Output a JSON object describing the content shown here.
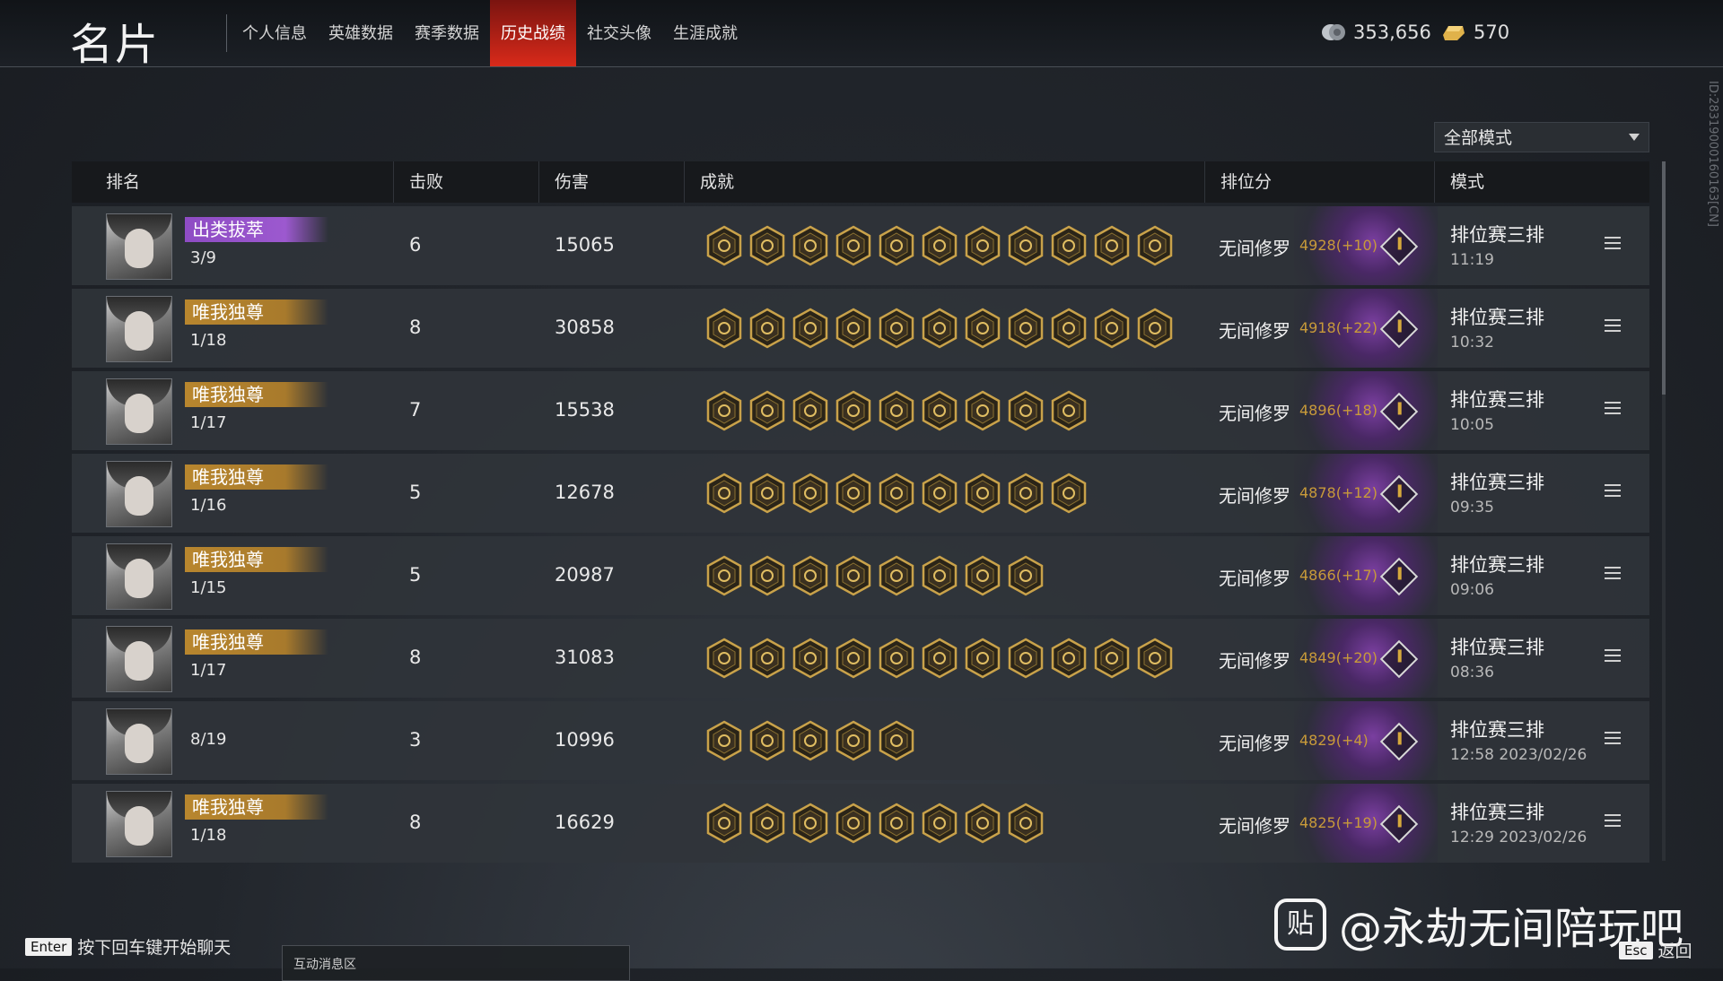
{
  "header": {
    "title": "名片",
    "tabs": [
      {
        "label": "个人信息",
        "active": false
      },
      {
        "label": "英雄数据",
        "active": false
      },
      {
        "label": "赛季数据",
        "active": false
      },
      {
        "label": "历史战绩",
        "active": true
      },
      {
        "label": "社交头像",
        "active": false
      },
      {
        "label": "生涯成就",
        "active": false
      }
    ],
    "currency_1": {
      "icon": "silver-coin-icon",
      "value": "353,656"
    },
    "currency_2": {
      "icon": "gold-ingot-icon",
      "value": "570"
    }
  },
  "filter": {
    "selected": "全部模式"
  },
  "table": {
    "columns": [
      "排名",
      "击败",
      "伤害",
      "成就",
      "排位分",
      "模式"
    ],
    "rows": [
      {
        "badge": "出类拔萃",
        "badge_color": "#9c59cf",
        "placement": "3/9",
        "kills": "6",
        "damage": "15065",
        "achievements": 11,
        "rank": "无间修罗",
        "score": "4928(+10)",
        "mode": "排位赛三排",
        "time": "11:19"
      },
      {
        "badge": "唯我独尊",
        "badge_color": "#b8862e",
        "placement": "1/18",
        "kills": "8",
        "damage": "30858",
        "achievements": 11,
        "rank": "无间修罗",
        "score": "4918(+22)",
        "mode": "排位赛三排",
        "time": "10:32"
      },
      {
        "badge": "唯我独尊",
        "badge_color": "#b8862e",
        "placement": "1/17",
        "kills": "7",
        "damage": "15538",
        "achievements": 9,
        "rank": "无间修罗",
        "score": "4896(+18)",
        "mode": "排位赛三排",
        "time": "10:05"
      },
      {
        "badge": "唯我独尊",
        "badge_color": "#b8862e",
        "placement": "1/16",
        "kills": "5",
        "damage": "12678",
        "achievements": 9,
        "rank": "无间修罗",
        "score": "4878(+12)",
        "mode": "排位赛三排",
        "time": "09:35"
      },
      {
        "badge": "唯我独尊",
        "badge_color": "#b8862e",
        "placement": "1/15",
        "kills": "5",
        "damage": "20987",
        "achievements": 8,
        "rank": "无间修罗",
        "score": "4866(+17)",
        "mode": "排位赛三排",
        "time": "09:06"
      },
      {
        "badge": "唯我独尊",
        "badge_color": "#b8862e",
        "placement": "1/17",
        "kills": "8",
        "damage": "31083",
        "achievements": 11,
        "rank": "无间修罗",
        "score": "4849(+20)",
        "mode": "排位赛三排",
        "time": "08:36"
      },
      {
        "badge": "",
        "badge_color": "",
        "placement": "8/19",
        "kills": "3",
        "damage": "10996",
        "achievements": 5,
        "rank": "无间修罗",
        "score": "4829(+4)",
        "mode": "排位赛三排",
        "time": "12:58  2023/02/26"
      },
      {
        "badge": "唯我独尊",
        "badge_color": "#b8862e",
        "placement": "1/18",
        "kills": "8",
        "damage": "16629",
        "achievements": 8,
        "rank": "无间修罗",
        "score": "4825(+19)",
        "mode": "排位赛三排",
        "time": "12:29  2023/02/26"
      }
    ]
  },
  "side_id": "ID:2831900016016​3[CN]",
  "footer": {
    "enter_key": "Enter",
    "chat_hint": "按下回车键开始聊天",
    "interact_label": "互动消息区",
    "watermark_logo": "贴",
    "watermark_text": "@永劫无间陪玩吧",
    "esc_key": "Esc",
    "esc_label": "返回"
  },
  "colors": {
    "accent": "#d92a1a",
    "gold": "#c89a3a",
    "purple": "#9c59cf"
  }
}
